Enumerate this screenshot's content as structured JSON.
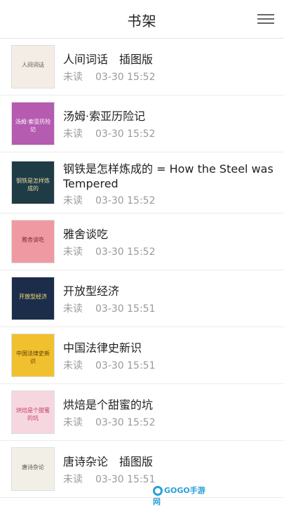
{
  "header": {
    "title": "书架",
    "menu_icon": "hamburger-menu-icon"
  },
  "books": [
    {
      "title": "人间词话　插图版",
      "status": "未读",
      "time": "03-30 15:52",
      "cover_text": "人间词话",
      "cover_bg": "#f3ede6",
      "cover_fg": "#555555"
    },
    {
      "title": "汤姆·索亚历险记",
      "status": "未读",
      "time": "03-30 15:52",
      "cover_text": "汤姆·索亚历险记",
      "cover_bg": "#b55bb0",
      "cover_fg": "#ffffff"
    },
    {
      "title": "钢铁是怎样炼成的 = How the Steel was Tempered",
      "status": "未读",
      "time": "03-30 15:52",
      "cover_text": "钢铁是怎样炼成的",
      "cover_bg": "#1f3b45",
      "cover_fg": "#e8d9a6"
    },
    {
      "title": "雅舍谈吃",
      "status": "未读",
      "time": "03-30 15:52",
      "cover_text": "雅舍谈吃",
      "cover_bg": "#ef9aa3",
      "cover_fg": "#7a2a2a"
    },
    {
      "title": "开放型经济",
      "status": "未读",
      "time": "03-30 15:51",
      "cover_text": "开放型经济",
      "cover_bg": "#1b2d4a",
      "cover_fg": "#ffe36e"
    },
    {
      "title": "中国法律史新识",
      "status": "未读",
      "time": "03-30 15:51",
      "cover_text": "中国法律史新识",
      "cover_bg": "#f1c02e",
      "cover_fg": "#5a3b00"
    },
    {
      "title": "烘焙是个甜蜜的坑",
      "status": "未读",
      "time": "03-30 15:52",
      "cover_text": "烘焙是个甜蜜的坑",
      "cover_bg": "#f7d7df",
      "cover_fg": "#c2406a"
    },
    {
      "title": "唐诗杂论　插图版",
      "status": "未读",
      "time": "03-30 15:51",
      "cover_text": "唐诗杂论",
      "cover_bg": "#f2efe6",
      "cover_fg": "#555555"
    }
  ],
  "watermark": {
    "text": "GOGO手游网"
  }
}
